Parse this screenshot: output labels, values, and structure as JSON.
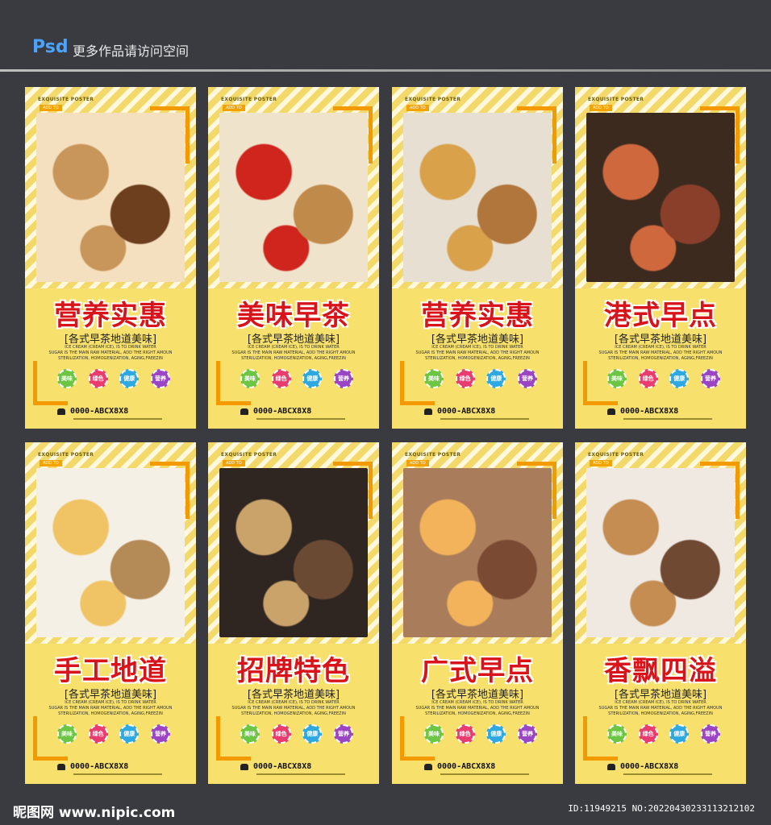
{
  "header": {
    "psd_label": "Psd",
    "more_text": "更多作品请访问空间"
  },
  "cards": [
    {
      "title": "营养实惠",
      "subtitle": "[各式早茶地道美味]",
      "photo_colors": [
        "#f4e0bf",
        "#c8965a",
        "#6d3f1e"
      ],
      "phone": "0000-ABCX8X8"
    },
    {
      "title": "美味早茶",
      "subtitle": "[各式早茶地道美味]",
      "photo_colors": [
        "#efe3cc",
        "#d0251d",
        "#c08a4a"
      ],
      "phone": "0000-ABCX8X8"
    },
    {
      "title": "营养实惠",
      "subtitle": "[各式早茶地道美味]",
      "photo_colors": [
        "#e6dfd2",
        "#d9a24a",
        "#b0763b"
      ],
      "phone": "0000-ABCX8X8"
    },
    {
      "title": "港式早点",
      "subtitle": "[各式早茶地道美味]",
      "photo_colors": [
        "#3c2a1f",
        "#d0683e",
        "#8a3f2a"
      ],
      "phone": "0000-ABCX8X8"
    },
    {
      "title": "手工地道",
      "subtitle": "[各式早茶地道美味]",
      "photo_colors": [
        "#f5f0e6",
        "#f0c464",
        "#b48a56"
      ],
      "phone": "0000-ABCX8X8"
    },
    {
      "title": "招牌特色",
      "subtitle": "[各式早茶地道美味]",
      "photo_colors": [
        "#2f2621",
        "#caa36b",
        "#6b4a34"
      ],
      "phone": "0000-ABCX8X8"
    },
    {
      "title": "广式早点",
      "subtitle": "[各式早茶地道美味]",
      "photo_colors": [
        "#a97c5c",
        "#f2b35a",
        "#7a4a33"
      ],
      "phone": "0000-ABCX8X8"
    },
    {
      "title": "香飘四溢",
      "subtitle": "[各式早茶地道美味]",
      "photo_colors": [
        "#efe9e2",
        "#c58d52",
        "#6f4932"
      ],
      "phone": "0000-ABCX8X8"
    }
  ],
  "card_common": {
    "poster_tag": "EXQUISITE POSTER",
    "add_tag": "ADD TO",
    "desc_lines": [
      "ICE CREAM (CREAM ICE), IS TO DRINK WATER",
      "SUGAR IS THE MAIN RAW MATERIAL, ADD THE RIGHT AMOUN",
      "STERILIZATION, HOMOGENIZATION, AGING,FREEZIN"
    ],
    "badges": [
      {
        "label": "美味",
        "color": "#6cc644"
      },
      {
        "label": "绿色",
        "color": "#e83c6f"
      },
      {
        "label": "健康",
        "color": "#2ea8e0"
      },
      {
        "label": "营养",
        "color": "#9b45c4"
      }
    ]
  },
  "footer": {
    "logo": "昵图网 www.nipic.com",
    "id_text": "ID:11949215 NO:20220430233113212102"
  }
}
